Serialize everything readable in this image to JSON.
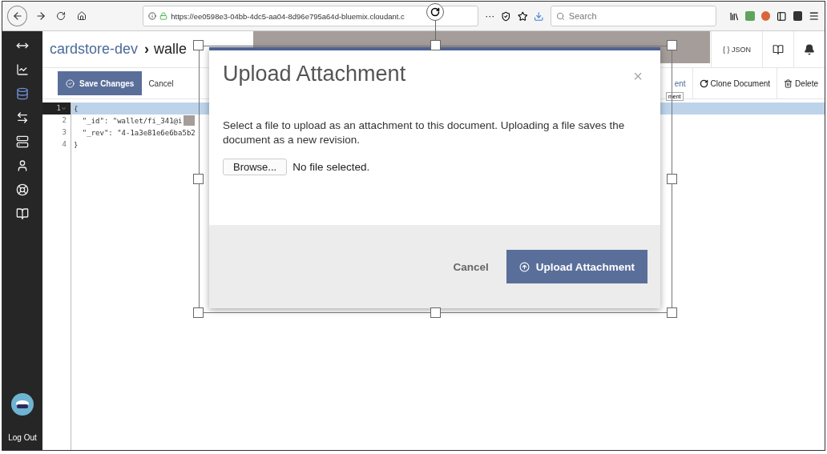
{
  "browser": {
    "url": "https://ee0598e3-04bb-4dc5-aa04-8d96e795a64d-bluemix.cloudant.c",
    "more": "···",
    "search": {
      "placeholder": "Search"
    }
  },
  "sidebar": {
    "items": [
      {
        "kind": "expand",
        "selected": false
      },
      {
        "kind": "chart",
        "selected": false
      },
      {
        "kind": "database",
        "selected": true
      },
      {
        "kind": "replication",
        "selected": false
      },
      {
        "kind": "servers",
        "selected": false
      },
      {
        "kind": "account",
        "selected": false
      },
      {
        "kind": "support",
        "selected": false
      },
      {
        "kind": "docs",
        "selected": false
      }
    ],
    "logout": "Log Out"
  },
  "header": {
    "breadcrumb": [
      "cardstore-dev",
      "walle"
    ],
    "separator": "›",
    "json_button": "{ } JSON"
  },
  "toolbar": {
    "save": "Save Changes",
    "cancel": "Cancel",
    "partial_action": "ent",
    "clone": "Clone Document",
    "delete": "Delete",
    "tooltip": "ment"
  },
  "editor": {
    "lines": [
      {
        "number": "1",
        "code": "{",
        "active": true
      },
      {
        "number": "2",
        "code": "  \"_id\": \"wallet/fi_341@i",
        "active": false
      },
      {
        "number": "3",
        "code": "  \"_rev\": \"4-1a3e81e6e6ba5b2",
        "active": false
      },
      {
        "number": "4",
        "code": "}",
        "active": false
      }
    ]
  },
  "modal": {
    "title": "Upload Attachment",
    "close": "×",
    "description": "Select a file to upload as an attachment to this document. Uploading a file saves the document as a new revision.",
    "browse": "Browse...",
    "file_status": "No file selected.",
    "cancel": "Cancel",
    "upload": "Upload Attachment"
  }
}
